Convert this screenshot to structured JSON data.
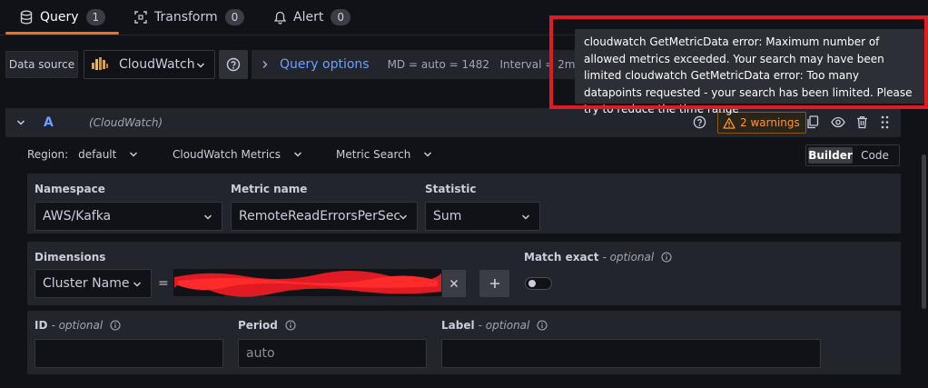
{
  "tabs": [
    {
      "label": "Query",
      "count": "1"
    },
    {
      "label": "Transform",
      "count": "0"
    },
    {
      "label": "Alert",
      "count": "0"
    }
  ],
  "datasource": {
    "label": "Data source",
    "selected": "CloudWatch"
  },
  "query_options": {
    "title": "Query options",
    "info": "MD = auto = 1482   Interval = 2m"
  },
  "query": {
    "ref_id": "A",
    "datasource_name": "(CloudWatch)",
    "warnings": "2 warnings"
  },
  "region": {
    "label": "Region:",
    "value": "default",
    "metrics_source": "CloudWatch Metrics",
    "search_type": "Metric Search",
    "mode_builder": "Builder",
    "mode_code": "Code"
  },
  "fields": {
    "namespace_label": "Namespace",
    "namespace_value": "AWS/Kafka",
    "metric_label": "Metric name",
    "metric_value": "RemoteReadErrorsPerSec",
    "statistic_label": "Statistic",
    "statistic_value": "Sum",
    "dimensions_label": "Dimensions",
    "dimension_key": "Cluster Name",
    "dimension_op": "=",
    "match_exact_label": "Match exact",
    "optional": "- optional",
    "id_label": "ID",
    "period_label": "Period",
    "period_placeholder": "auto",
    "label_label": "Label"
  },
  "tooltip": {
    "text": "cloudwatch GetMetricData error: Maximum number of allowed metrics exceeded. Your search may have been limited cloudwatch GetMetricData error: Too many datapoints requested - your search has been limited. Please try to reduce the time range"
  },
  "colors": {
    "accent": "#f56d23",
    "link": "#6e9fff",
    "warning": "#ff9830",
    "highlight_box": "#e01b24"
  }
}
